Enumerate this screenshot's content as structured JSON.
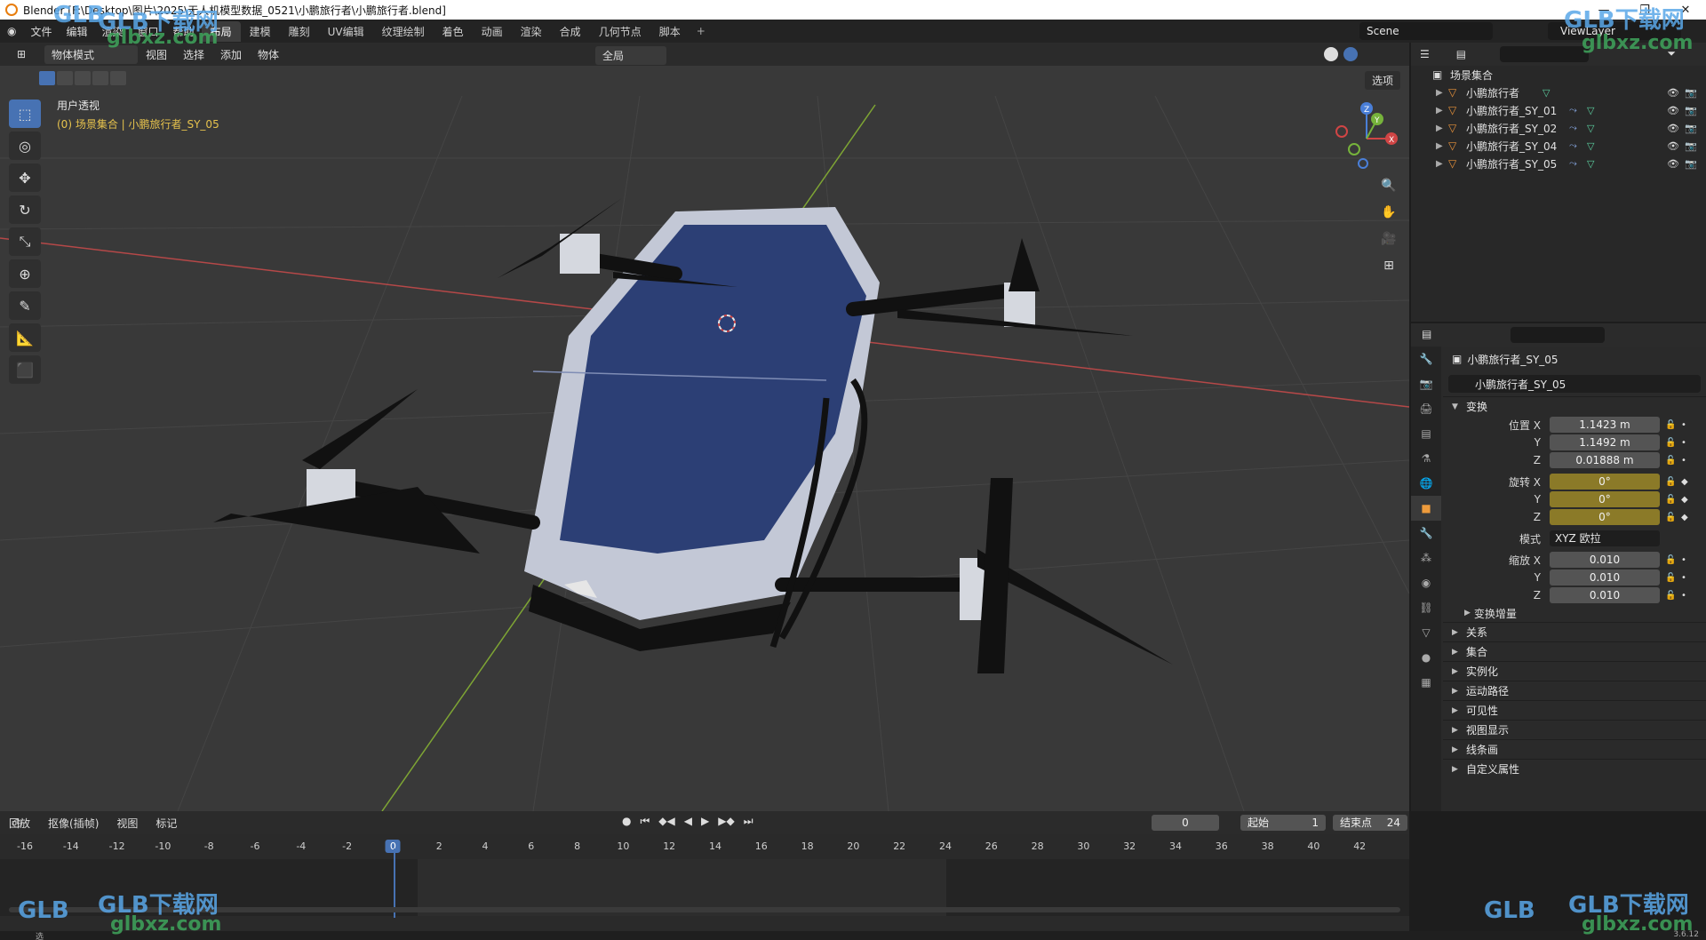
{
  "window": {
    "title": "Blender [F:\\Desktop\\图片\\2025\\无人机模型数据_0521\\小鹏旅行者\\小鹏旅行者.blend]",
    "controls": [
      "—",
      "❐",
      "✕"
    ]
  },
  "topbar": {
    "menus": [
      "文件",
      "编辑",
      "渲染",
      "窗口",
      "帮助"
    ],
    "workspaces": [
      "布局",
      "建模",
      "雕刻",
      "UV编辑",
      "纹理绘制",
      "着色",
      "动画",
      "渲染",
      "合成",
      "几何节点",
      "脚本"
    ],
    "active_workspace": "布局",
    "add_tab": "+",
    "scene": "Scene",
    "view_layer": "ViewLayer"
  },
  "viewport": {
    "mode": "物体模式",
    "menus": [
      "视图",
      "选择",
      "添加",
      "物体"
    ],
    "transform_space": "全局",
    "options": "选项",
    "view_name": "用户透视",
    "object_info": "(0) 场景集合 | 小鹏旅行者_SY_05",
    "tools": [
      "select-box",
      "cursor",
      "move",
      "rotate",
      "scale",
      "transform",
      "annotate",
      "measure",
      "add-cube"
    ],
    "gizmo_axes": [
      "X",
      "Y",
      "Z"
    ]
  },
  "outliner": {
    "root": "场景集合",
    "items": [
      {
        "name": "小鹏旅行者",
        "has_modifier": false
      },
      {
        "name": "小鹏旅行者_SY_01",
        "has_modifier": true
      },
      {
        "name": "小鹏旅行者_SY_02",
        "has_modifier": true
      },
      {
        "name": "小鹏旅行者_SY_04",
        "has_modifier": true
      },
      {
        "name": "小鹏旅行者_SY_05",
        "has_modifier": true
      }
    ]
  },
  "properties": {
    "object_title": "小鹏旅行者_SY_05",
    "object_name": "小鹏旅行者_SY_05",
    "transform_panel": "变换",
    "location_label": "位置 X",
    "location": {
      "x": "1.1423 m",
      "y": "1.1492 m",
      "z": "0.01888 m"
    },
    "rotation_label": "旋转 X",
    "rotation": {
      "x": "0°",
      "y": "0°",
      "z": "0°"
    },
    "mode_label": "模式",
    "rotation_mode": "XYZ 欧拉",
    "scale_label": "缩放 X",
    "scale": {
      "x": "0.010",
      "y": "0.010",
      "z": "0.010"
    },
    "axis_y": "Y",
    "axis_z": "Z",
    "delta_transform": "变换增量",
    "panels": [
      "关系",
      "集合",
      "实例化",
      "运动路径",
      "可见性",
      "视图显示",
      "线条画",
      "自定义属性"
    ]
  },
  "timeline": {
    "menus": [
      "回放",
      "抠像(插帧)",
      "视图",
      "标记"
    ],
    "current_frame": "0",
    "start_label": "起始",
    "start": "1",
    "end_label": "结束点",
    "end": "24",
    "ruler": [
      "-16",
      "-14",
      "-12",
      "-10",
      "-8",
      "-6",
      "-4",
      "-2",
      "0",
      "2",
      "4",
      "6",
      "8",
      "10",
      "12",
      "14",
      "16",
      "18",
      "20",
      "22",
      "24",
      "26",
      "28",
      "30",
      "32",
      "34",
      "36",
      "38",
      "40",
      "42"
    ]
  },
  "status": {
    "left": "选",
    "version": "3.6.12"
  },
  "watermarks": {
    "brand": "GLB下载网",
    "domain": "glbxz.com",
    "logo": "GLB"
  }
}
